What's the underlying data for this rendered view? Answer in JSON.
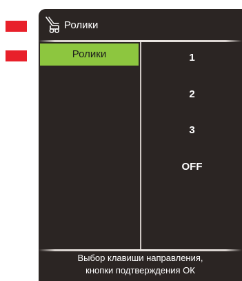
{
  "header": {
    "icon": "mouse-roller-icon",
    "title": "Ролики"
  },
  "menu": {
    "selected_item": "Ролики"
  },
  "options": [
    "1",
    "2",
    "3",
    "OFF"
  ],
  "footer": {
    "line1": "Выбор клавиши направления,",
    "line2": "кнопки подтверждения ОК"
  },
  "colors": {
    "marker": "#e8202a",
    "panel_bg": "#2b2523",
    "selected_bg": "#8dc63f"
  }
}
